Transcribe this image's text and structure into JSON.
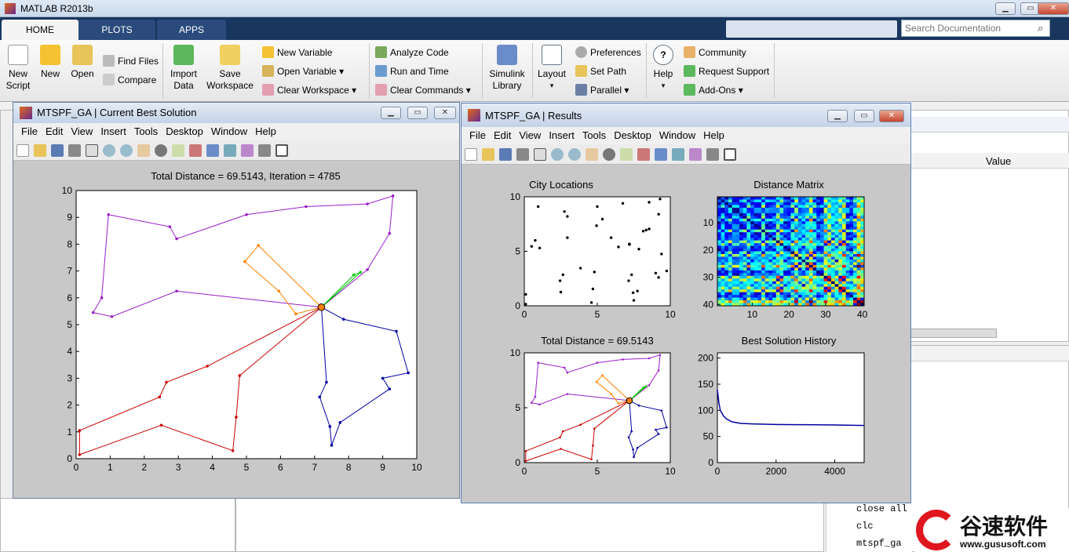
{
  "app": {
    "title": "MATLAB R2013b"
  },
  "tabs": [
    {
      "label": "HOME"
    },
    {
      "label": "PLOTS"
    },
    {
      "label": "APPS"
    }
  ],
  "search": {
    "placeholder": "Search Documentation"
  },
  "ribbon": {
    "new_script": "New\nScript",
    "new": "New",
    "open": "Open",
    "find_files": "Find Files",
    "compare": "Compare",
    "import_data": "Import\nData",
    "save_workspace": "Save\nWorkspace",
    "new_variable": "New Variable",
    "open_variable": "Open Variable",
    "clear_workspace": "Clear Workspace",
    "analyze_code": "Analyze Code",
    "run_and_time": "Run and Time",
    "clear_commands": "Clear Commands",
    "simulink_library": "Simulink\nLibrary",
    "layout": "Layout",
    "preferences": "Preferences",
    "set_path": "Set Path",
    "parallel": "Parallel",
    "help": "Help",
    "community": "Community",
    "request_support": "Request Support",
    "addons": "Add-Ons"
  },
  "workspace": {
    "value_header": "Value"
  },
  "command_history": [
    "close all",
    "clc",
    "mtspf_ga"
  ],
  "watermark": {
    "brand": "谷速软件",
    "url": "www.gususoft.com"
  },
  "fig1": {
    "title": "MTSPF_GA | Current Best Solution",
    "menu": [
      "File",
      "Edit",
      "View",
      "Insert",
      "Tools",
      "Desktop",
      "Window",
      "Help"
    ],
    "plot_title": "Total Distance = 69.5143, Iteration = 4785",
    "xticks": [
      "0",
      "1",
      "2",
      "3",
      "4",
      "5",
      "6",
      "7",
      "8",
      "9",
      "10"
    ],
    "yticks": [
      "0",
      "1",
      "2",
      "3",
      "4",
      "5",
      "6",
      "7",
      "8",
      "9",
      "10"
    ]
  },
  "fig2": {
    "title": "MTSPF_GA | Results",
    "menu": [
      "File",
      "Edit",
      "View",
      "Insert",
      "Tools",
      "Desktop",
      "Window",
      "Help"
    ],
    "city_title": "City Locations",
    "dist_title": "Distance Matrix",
    "route_title": "Total Distance = 69.5143",
    "hist_title": "Best Solution History",
    "city_xticks": [
      "0",
      "5",
      "10"
    ],
    "city_yticks": [
      "0",
      "5",
      "10"
    ],
    "dist_xticks": [
      "10",
      "20",
      "30",
      "40"
    ],
    "dist_yticks": [
      "10",
      "20",
      "30",
      "40"
    ],
    "hist_xticks": [
      "0",
      "2000",
      "4000"
    ],
    "hist_yticks": [
      "0",
      "50",
      "100",
      "150",
      "200"
    ]
  },
  "chart_data": {
    "type": "line",
    "depot": [
      7.2,
      5.65
    ],
    "series": [
      {
        "color": "#9a20c8",
        "points": [
          [
            7.2,
            5.65
          ],
          [
            2.95,
            6.25
          ],
          [
            1.05,
            5.3
          ],
          [
            0.5,
            5.45
          ],
          [
            0.75,
            6.0
          ],
          [
            0.95,
            9.1
          ],
          [
            2.75,
            8.65
          ],
          [
            2.95,
            8.2
          ],
          [
            5.0,
            9.1
          ],
          [
            6.75,
            9.4
          ],
          [
            8.55,
            9.5
          ],
          [
            9.3,
            9.8
          ],
          [
            9.2,
            8.4
          ],
          [
            8.55,
            7.05
          ],
          [
            7.2,
            5.65
          ]
        ]
      },
      {
        "color": "#ff8000",
        "points": [
          [
            7.2,
            5.65
          ],
          [
            5.35,
            7.95
          ],
          [
            4.95,
            7.35
          ],
          [
            5.95,
            6.25
          ],
          [
            6.45,
            5.4
          ],
          [
            7.2,
            5.65
          ]
        ]
      },
      {
        "color": "#00c800",
        "points": [
          [
            7.2,
            5.65
          ],
          [
            8.15,
            6.85
          ],
          [
            8.35,
            6.95
          ],
          [
            7.2,
            5.65
          ]
        ]
      },
      {
        "color": "#0000a0",
        "points": [
          [
            7.2,
            5.65
          ],
          [
            7.35,
            2.85
          ],
          [
            7.15,
            2.3
          ],
          [
            7.45,
            1.2
          ],
          [
            7.5,
            0.5
          ],
          [
            7.75,
            1.35
          ],
          [
            9.2,
            2.6
          ],
          [
            9.0,
            3.0
          ],
          [
            9.75,
            3.2
          ],
          [
            9.4,
            4.75
          ],
          [
            7.85,
            5.2
          ],
          [
            7.2,
            5.65
          ]
        ]
      },
      {
        "color": "#c80000",
        "points": [
          [
            7.2,
            5.65
          ],
          [
            3.85,
            3.45
          ],
          [
            2.65,
            2.85
          ],
          [
            2.45,
            2.3
          ],
          [
            0.1,
            1.05
          ],
          [
            0.1,
            0.15
          ],
          [
            2.5,
            1.25
          ],
          [
            4.6,
            0.3
          ],
          [
            4.7,
            1.55
          ],
          [
            4.8,
            3.1
          ],
          [
            7.2,
            5.65
          ]
        ]
      }
    ],
    "best_history": {
      "x": [
        0,
        50,
        100,
        200,
        300,
        500,
        800,
        1200,
        2000,
        3000,
        4000,
        5000
      ],
      "y": [
        140,
        115,
        100,
        90,
        84,
        78,
        75,
        74,
        73,
        72.5,
        72,
        71
      ]
    }
  }
}
